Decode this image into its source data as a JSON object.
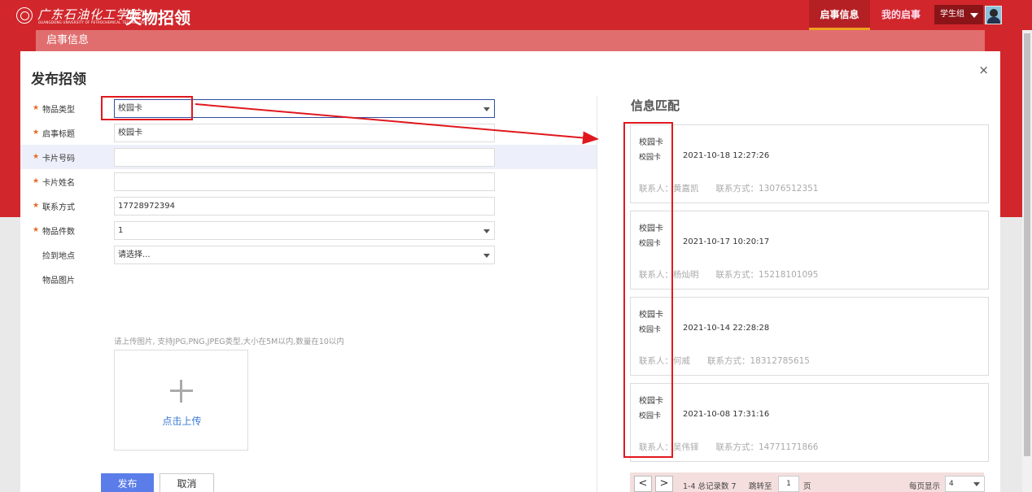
{
  "header": {
    "logo_cn": "广东石油化工学院",
    "logo_en": "GUANGDONG UNIVERSITY OF PETROCHEMICAL TECHNOLOGY",
    "app_title": "失物招领",
    "nav": [
      "启事信息",
      "我的启事"
    ],
    "user_menu": "学生组"
  },
  "breadcrumb": "启事信息",
  "modal": {
    "title": "发布招领",
    "close": "×",
    "fields": [
      {
        "label": "物品类型",
        "value": "校园卡",
        "required": true,
        "type": "select"
      },
      {
        "label": "启事标题",
        "value": "校园卡",
        "required": true,
        "type": "text"
      },
      {
        "label": "卡片号码",
        "value": "",
        "required": true,
        "type": "text"
      },
      {
        "label": "卡片姓名",
        "value": "",
        "required": true,
        "type": "text"
      },
      {
        "label": "联系方式",
        "value": "17728972394",
        "required": true,
        "type": "text"
      },
      {
        "label": "物品件数",
        "value": "1",
        "required": true,
        "type": "select"
      },
      {
        "label": "捡到地点",
        "value": "请选择...",
        "required": false,
        "type": "select"
      }
    ],
    "image_label": "物品图片",
    "upload_hint": "请上传图片, 支持JPG,PNG,JPEG类型,大小在5M以内,数量在10以内",
    "upload_text": "点击上传",
    "publish": "发布",
    "cancel": "取消"
  },
  "match": {
    "title": "信息匹配",
    "cards": [
      {
        "head": "校园卡",
        "category": "校园卡",
        "time": "2021-10-18 12:27:26",
        "contact": "联系人：黄嘉凯　　联系方式：13076512351"
      },
      {
        "head": "校园卡",
        "category": "校园卡",
        "time": "2021-10-17 10:20:17",
        "contact": "联系人：杨灿明　　联系方式：15218101095"
      },
      {
        "head": "校园卡",
        "category": "校园卡",
        "time": "2021-10-14 22:28:28",
        "contact": "联系人：何威　　联系方式：18312785615"
      },
      {
        "head": "校园卡",
        "category": "校园卡",
        "time": "2021-10-08 17:31:16",
        "contact": "联系人：吴伟铎　　联系方式：14771171866"
      }
    ]
  },
  "pager": {
    "prev": "<",
    "next": ">",
    "summary": "1-4 总记录数 7",
    "jump_label": "跳转至",
    "jump_value": "1",
    "page_unit": "页",
    "size_label": "每页显示",
    "size_value": "4"
  },
  "colors": {
    "brand_red": "#d1272c",
    "accent_blue": "#5b7de9",
    "annotation_red": "#e0181e"
  }
}
